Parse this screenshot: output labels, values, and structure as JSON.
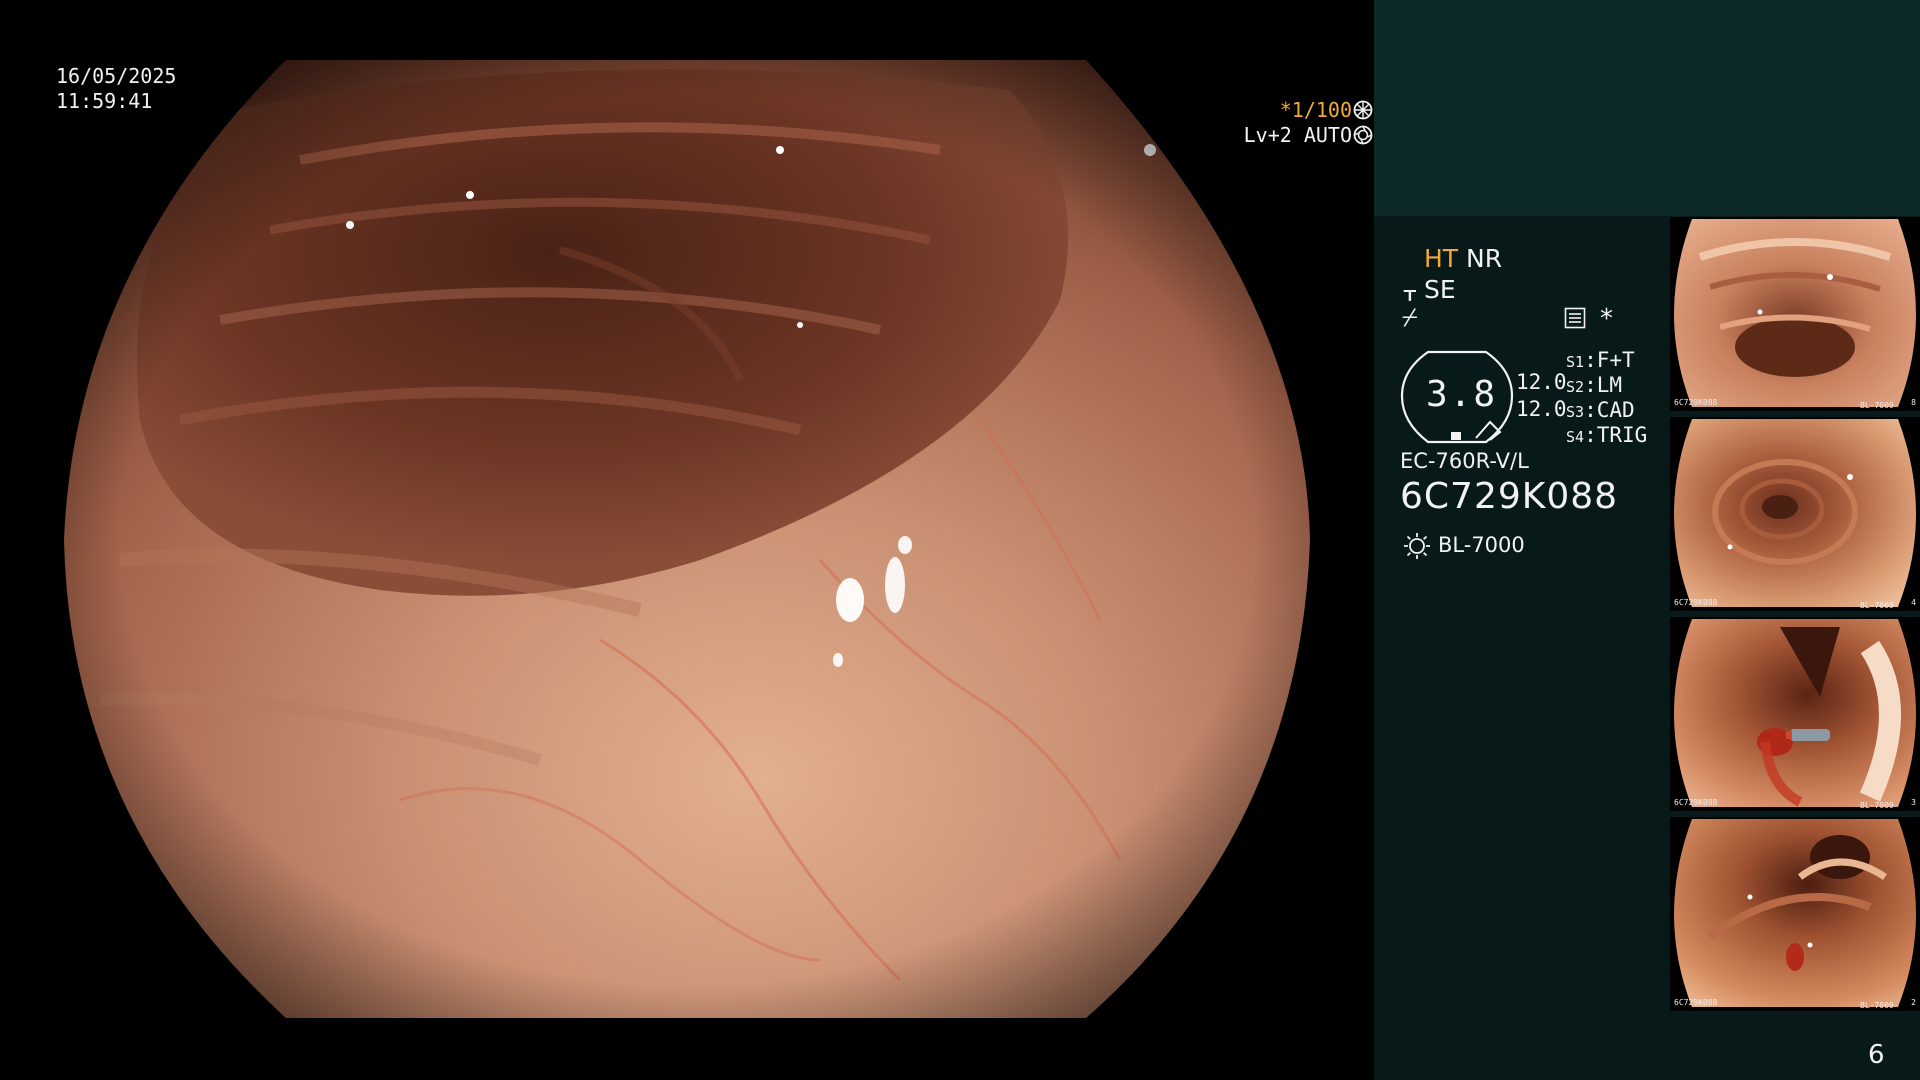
{
  "main": {
    "date": "16/05/2025",
    "time": "11:59:41",
    "shutter_speed": "*1/100",
    "enhancement_level": "Lv+2",
    "iris_mode": "AUTO"
  },
  "panel": {
    "mode_ht": "HT",
    "mode_nr": "NR",
    "mode_se": "SE",
    "asterisk": "*",
    "pressure_value": "3.8",
    "gain_values": [
      "12.0",
      "12.0"
    ],
    "switches": [
      {
        "key": "S1",
        "value": "F+T"
      },
      {
        "key": "S2",
        "value": "LM"
      },
      {
        "key": "S3",
        "value": "CAD"
      },
      {
        "key": "S4",
        "value": "TRIG"
      }
    ],
    "scope_model": "EC-760R-V/L",
    "scope_serial": "6C729K088",
    "light_source": "BL-7000",
    "page_number": "6"
  },
  "thumbnails": [
    {
      "serial": "6C729K088",
      "light_source": "BL-7000",
      "number": "8"
    },
    {
      "serial": "6C729K088",
      "light_source": "BL-7000",
      "number": "4"
    },
    {
      "serial": "6C729K088",
      "light_source": "BL-7000",
      "number": "3"
    },
    {
      "serial": "6C729K088",
      "light_source": "BL-7000",
      "number": "2"
    }
  ],
  "icons": {
    "shutter": "shutter-wheel-icon",
    "iris": "iris-icon",
    "signal": "signal-step-icon",
    "flash": "flash-slash-icon",
    "menu": "menu-list-icon",
    "light": "lamp-sun-icon"
  },
  "colors": {
    "osd_highlight": "#f1a93a",
    "panel_background": "#071a19",
    "panel_top": "#0c2927"
  }
}
